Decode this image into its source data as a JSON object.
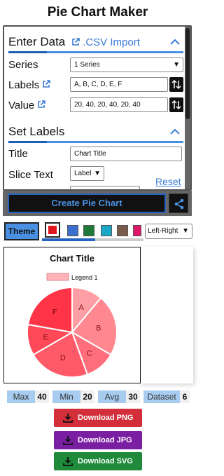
{
  "app": {
    "title": "Pie Chart Maker"
  },
  "enter_data": {
    "heading": "Enter Data",
    "csv_import": ".CSV Import",
    "series_label": "Series",
    "series_value": "1 Series",
    "labels_label": "Labels",
    "labels_value": "A, B, C, D, E, F",
    "value_label": "Value",
    "value_value": "20, 40, 20, 40, 20, 40"
  },
  "set_labels": {
    "heading": "Set Labels",
    "title_label": "Title",
    "title_value": "Chart Title",
    "slice_text_label": "Slice Text",
    "slice_text_value": "Label",
    "reset": "Reset"
  },
  "actions": {
    "create": "Create Pie Chart"
  },
  "theme": {
    "button": "Theme",
    "swatches": [
      "#e0161f",
      "#3a6fd0",
      "#1f7a3a",
      "#1aa8c8",
      "#7a5a4a",
      "#e0166a"
    ],
    "legend_position": "Left-Right"
  },
  "chart_data": {
    "type": "pie",
    "title": "Chart Title",
    "legend": [
      "Legend 1"
    ],
    "categories": [
      "A",
      "B",
      "C",
      "D",
      "E",
      "F"
    ],
    "values": [
      20,
      40,
      20,
      40,
      20,
      40
    ],
    "colors": [
      "#ff9ea5",
      "#ff8790",
      "#ff6f7b",
      "#ff5a68",
      "#ff4858",
      "#ff3447"
    ]
  },
  "stats": {
    "max_label": "Max",
    "max_value": "40",
    "min_label": "Min",
    "min_value": "20",
    "avg_label": "Avg",
    "avg_value": "30",
    "dataset_label": "Dataset",
    "dataset_value": "6"
  },
  "downloads": {
    "png": "Download PNG",
    "jpg": "Download JPG",
    "svg": "Download SVG",
    "png_color": "#d32f3a",
    "jpg_color": "#7b1fa2",
    "svg_color": "#1e8a3a"
  }
}
